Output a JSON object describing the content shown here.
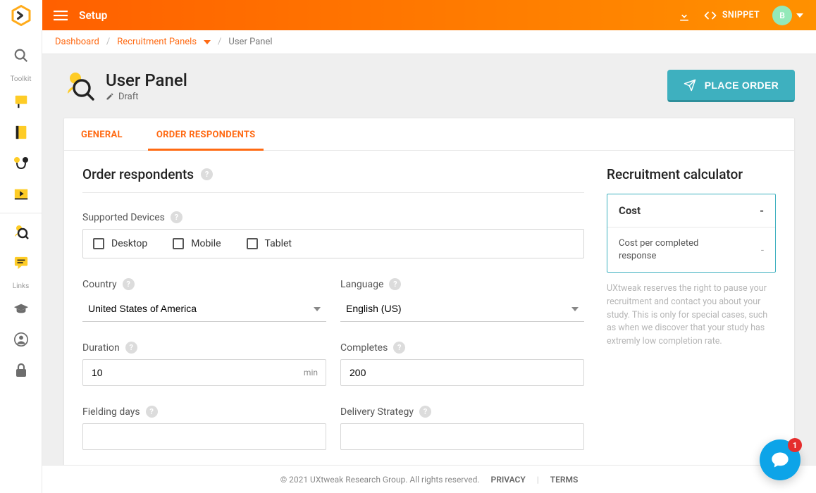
{
  "topbar": {
    "title": "Setup",
    "snippet_label": "SNIPPET",
    "avatar_initial": "B"
  },
  "sidebar": {
    "group1_label": "Toolkit",
    "group2_label": "Links"
  },
  "breadcrumb": {
    "items": [
      "Dashboard",
      "Recruitment Panels"
    ],
    "current": "User Panel"
  },
  "page": {
    "title": "User Panel",
    "status": "Draft",
    "place_order_label": "PLACE ORDER"
  },
  "tabs": {
    "general": "GENERAL",
    "order": "ORDER RESPONDENTS"
  },
  "form": {
    "section_title": "Order respondents",
    "devices_label": "Supported Devices",
    "devices": {
      "desktop": "Desktop",
      "mobile": "Mobile",
      "tablet": "Tablet"
    },
    "country_label": "Country",
    "country_value": "United States of America",
    "language_label": "Language",
    "language_value": "English (US)",
    "duration_label": "Duration",
    "duration_value": "10",
    "duration_suffix": "min",
    "completes_label": "Completes",
    "completes_value": "200",
    "fielding_label": "Fielding days",
    "delivery_label": "Delivery Strategy"
  },
  "calc": {
    "title": "Recruitment calculator",
    "cost_label": "Cost",
    "cost_value": "-",
    "per_label": "Cost per completed response",
    "per_value": "-",
    "note": "UXtweak reserves the right to pause your recruitment and contact you about your study. This is only for special cases, such as when we discover that your study has extremly low completion rate."
  },
  "footer": {
    "copy": "© 2021 UXtweak Research Group. All rights reserved.",
    "privacy": "PRIVACY",
    "terms": "TERMS"
  },
  "chat": {
    "badge": "1"
  }
}
